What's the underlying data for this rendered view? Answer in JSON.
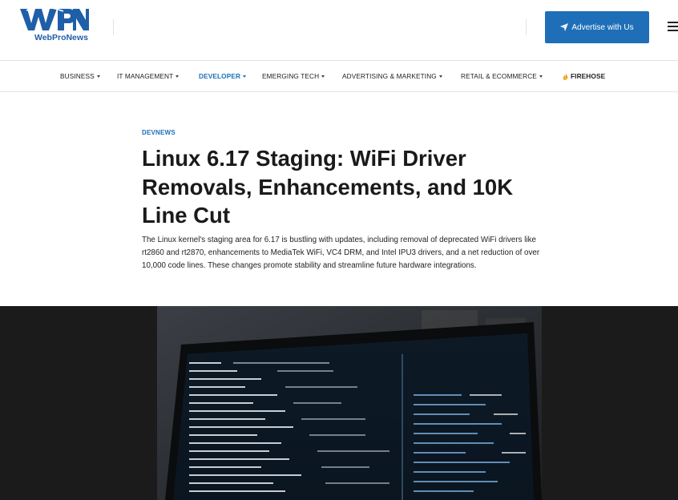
{
  "header": {
    "logo_mark_text": "WPN",
    "logo_text": "WebProNews",
    "advertise_label": "Advertise with Us"
  },
  "nav": {
    "items": [
      {
        "label": "BUSINESS"
      },
      {
        "label": "IT MANAGEMENT"
      },
      {
        "label": "DEVELOPER"
      },
      {
        "label": "EMERGING TECH"
      },
      {
        "label": "ADVERTISING & MARKETING"
      },
      {
        "label": "RETAIL & ECOMMERCE"
      },
      {
        "label": "FIREHOSE"
      }
    ],
    "active": "DEVELOPER"
  },
  "article": {
    "category": "DEVNEWS",
    "headline": "Linux 6.17 Staging: WiFi Driver Removals, Enhancements, and 10K Line Cut",
    "excerpt": "The Linux kernel's staging area for 6.17 is bustling with updates, including removal of deprecated WiFi drivers like rt2860 and rt2870, enhancements to MediaTek WiFi, VC4 DRM, and Intel IPU3 drivers, and a net reduction of over 10,000 code lines. These changes promote stability and streamline future hardware integrations."
  },
  "colors": {
    "brand_blue": "#1f6fb8",
    "logo_blue": "#1f5fa8",
    "hero_band": "#1b1b1b"
  }
}
